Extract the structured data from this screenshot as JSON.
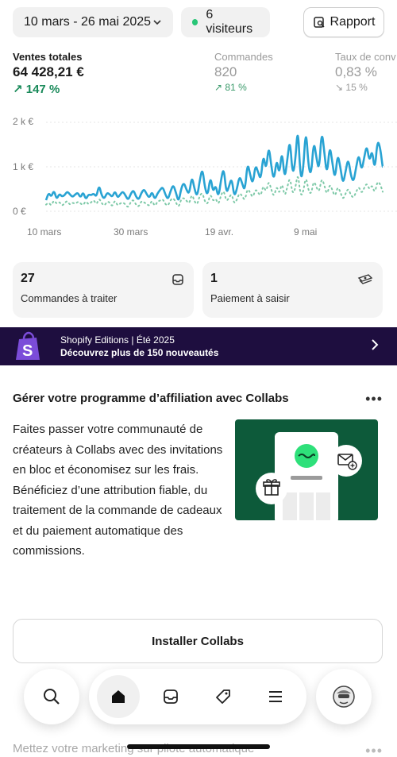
{
  "filters": {
    "date_range": "10 mars - 26 mai 2025",
    "visitors": "6 visiteurs",
    "report_label": "Rapport"
  },
  "metrics": {
    "sales": {
      "label": "Ventes totales",
      "value": "64 428,21 €",
      "delta": "147 %"
    },
    "orders": {
      "label": "Commandes",
      "value": "820",
      "delta": "81 %"
    },
    "conversion": {
      "label": "Taux de conv",
      "value": "0,83 %",
      "delta": "15 %"
    }
  },
  "chart_data": {
    "type": "line",
    "y_ticks": [
      "2 k €",
      "1 k €",
      "0 €"
    ],
    "ylim": [
      0,
      2000
    ],
    "x_ticks": [
      "10 mars",
      "30 mars",
      "19 avr.",
      "9 mai"
    ],
    "x_dates": [
      "2025-03-10",
      "2025-03-30",
      "2025-04-19",
      "2025-05-09"
    ],
    "grid": true,
    "series": [
      {
        "style": "solid",
        "color": "#29a3d3",
        "values": [
          250,
          420,
          320,
          480,
          260,
          400,
          330,
          360,
          450,
          380,
          320,
          380,
          420,
          300,
          440,
          260,
          380,
          360,
          400,
          320,
          600,
          350,
          280,
          420,
          380,
          320,
          460,
          300,
          380,
          450,
          350,
          250,
          400,
          480,
          320,
          260,
          420,
          500,
          380,
          300,
          450,
          260,
          400,
          480,
          550,
          380,
          260,
          460,
          600,
          420,
          200,
          520,
          650,
          480,
          380,
          800,
          500,
          320,
          700,
          980,
          500,
          350,
          800,
          420,
          600,
          300,
          700,
          1000,
          400,
          550,
          760,
          320,
          500,
          800,
          620,
          450,
          1100,
          820,
          600,
          1050,
          880,
          700,
          1300,
          900,
          1500,
          1000,
          680,
          1200,
          800,
          1400,
          700,
          1150,
          1650,
          800,
          1100,
          1950,
          700,
          900,
          1900,
          1000,
          800,
          1600,
          1200,
          900,
          1850,
          1300,
          800,
          1500,
          1100,
          700,
          1300,
          1000,
          600,
          900,
          1200,
          800,
          650,
          1000,
          1300,
          900,
          1200,
          1500,
          1100,
          1400,
          900,
          1600,
          1450,
          1000
        ]
      },
      {
        "style": "dotted",
        "color": "#7ec9a8",
        "values": [
          150,
          200,
          120,
          260,
          160,
          220,
          120,
          180,
          240,
          140,
          200,
          160,
          220,
          180,
          130,
          240,
          150,
          200,
          260,
          140,
          300,
          180,
          120,
          220,
          200,
          100,
          260,
          120,
          180,
          200,
          150,
          80,
          220,
          260,
          140,
          100,
          240,
          200,
          160,
          120,
          260,
          100,
          220,
          240,
          280,
          160,
          120,
          260,
          300,
          200,
          80,
          280,
          300,
          240,
          160,
          400,
          220,
          140,
          360,
          420,
          200,
          160,
          400,
          220,
          300,
          140,
          360,
          480,
          220,
          300,
          400,
          160,
          260,
          420,
          340,
          240,
          520,
          420,
          300,
          500,
          420,
          340,
          600,
          420,
          700,
          480,
          320,
          580,
          380,
          660,
          320,
          540,
          780,
          380,
          500,
          880,
          340,
          420,
          800,
          460,
          380,
          700,
          540,
          420,
          760,
          580,
          360,
          620,
          480,
          320,
          560,
          440,
          260,
          400,
          520,
          360,
          300,
          440,
          560,
          400,
          520,
          640,
          480,
          600,
          400,
          680,
          620,
          440
        ]
      }
    ]
  },
  "tasks": [
    {
      "count": "27",
      "label": "Commandes à traiter",
      "icon": "inbox-icon"
    },
    {
      "count": "1",
      "label": "Paiement à saisir",
      "icon": "cash-icon"
    }
  ],
  "banner": {
    "line1": "Shopify Editions | Été 2025",
    "line2": "Découvrez plus de 150 nouveautés"
  },
  "collabs": {
    "title": "Gérer votre programme d’affiliation avec Collabs",
    "body": "Faites passer votre communauté de créateurs à Collabs avec des invitations en bloc et économisez sur les frais. Bénéficiez d’une attribution fiable, du traitement de la commande de cadeaux et du paiement automatique des commissions.",
    "install_label": "Installer Collabs"
  },
  "next_section": {
    "title": "Mettez votre marketing sur pilote automatique"
  },
  "nav": {
    "items": [
      "search-icon",
      "home-icon",
      "inbox-icon",
      "tag-icon",
      "menu-icon",
      "profile-icon"
    ]
  },
  "colors": {
    "accent_green": "#29c677",
    "line_blue": "#29a3d3",
    "banner_purple": "#1e0e3f",
    "promo_green": "#0d5a3a"
  }
}
